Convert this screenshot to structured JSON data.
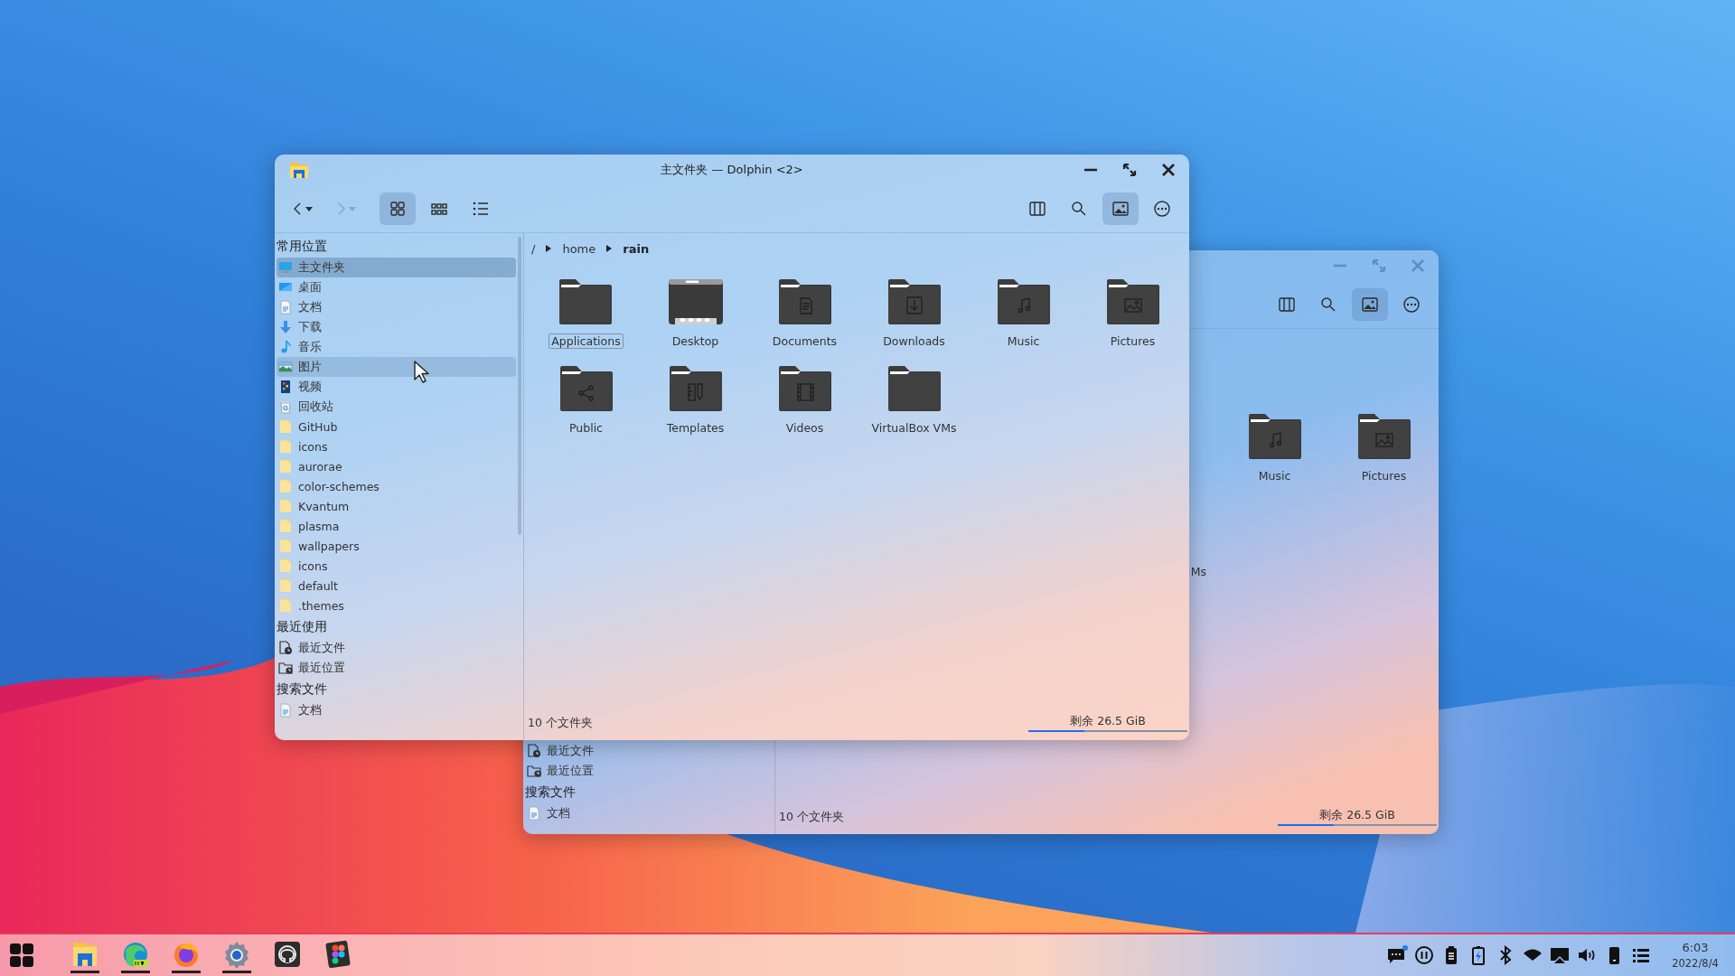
{
  "front_window": {
    "title": "主文件夹 — Dolphin <2>",
    "nav": [
      {
        "kind": "back",
        "disabled": false
      },
      {
        "kind": "forward",
        "disabled": true
      }
    ],
    "view_modes": [
      {
        "kind": "icons",
        "selected": true
      },
      {
        "kind": "compact",
        "selected": false
      },
      {
        "kind": "details",
        "selected": false
      }
    ],
    "tools": [
      {
        "kind": "split",
        "on": false
      },
      {
        "kind": "search",
        "on": false
      },
      {
        "kind": "preview",
        "on": true
      },
      {
        "kind": "menu",
        "on": false
      }
    ],
    "sidebar": [
      {
        "heading": "常用位置",
        "items": [
          {
            "label": "主文件夹",
            "kind": "computer",
            "selected": true,
            "hovered": false
          },
          {
            "label": "桌面",
            "kind": "desktop",
            "selected": false,
            "hovered": false
          },
          {
            "label": "文档",
            "kind": "document",
            "selected": false,
            "hovered": false
          },
          {
            "label": "下载",
            "kind": "download",
            "selected": false,
            "hovered": false
          },
          {
            "label": "音乐",
            "kind": "music",
            "selected": false,
            "hovered": false
          },
          {
            "label": "图片",
            "kind": "picture",
            "selected": false,
            "hovered": true
          },
          {
            "label": "视频",
            "kind": "video",
            "selected": false,
            "hovered": false
          },
          {
            "label": "回收站",
            "kind": "trash",
            "selected": false,
            "hovered": false
          },
          {
            "label": "GitHub",
            "kind": "folder",
            "selected": false,
            "hovered": false
          },
          {
            "label": "icons",
            "kind": "folder",
            "selected": false,
            "hovered": false
          },
          {
            "label": "aurorae",
            "kind": "folder",
            "selected": false,
            "hovered": false
          },
          {
            "label": "color-schemes",
            "kind": "folder",
            "selected": false,
            "hovered": false
          },
          {
            "label": "Kvantum",
            "kind": "folder",
            "selected": false,
            "hovered": false
          },
          {
            "label": "plasma",
            "kind": "folder",
            "selected": false,
            "hovered": false
          },
          {
            "label": "wallpapers",
            "kind": "folder",
            "selected": false,
            "hovered": false
          },
          {
            "label": "icons",
            "kind": "folder",
            "selected": false,
            "hovered": false
          },
          {
            "label": "default",
            "kind": "folder",
            "selected": false,
            "hovered": false
          },
          {
            "label": ".themes",
            "kind": "folder",
            "selected": false,
            "hovered": false
          }
        ]
      },
      {
        "heading": "最近使用",
        "items": [
          {
            "label": "最近文件",
            "kind": "recent-file",
            "selected": false,
            "hovered": false
          },
          {
            "label": "最近位置",
            "kind": "recent-place",
            "selected": false,
            "hovered": false
          }
        ]
      },
      {
        "heading": "搜索文件",
        "items": [
          {
            "label": "文档",
            "kind": "document",
            "selected": false,
            "hovered": false
          }
        ]
      }
    ],
    "breadcrumb": [
      {
        "label": "/",
        "current": false
      },
      {
        "label": "home",
        "current": false
      },
      {
        "label": "rain",
        "current": true
      }
    ],
    "folders": [
      {
        "label": "Applications",
        "kind": "plain",
        "focused": true
      },
      {
        "label": "Desktop",
        "kind": "desktop",
        "focused": false
      },
      {
        "label": "Documents",
        "kind": "document",
        "focused": false
      },
      {
        "label": "Downloads",
        "kind": "download",
        "focused": false
      },
      {
        "label": "Music",
        "kind": "music",
        "focused": false
      },
      {
        "label": "Pictures",
        "kind": "picture",
        "focused": false
      },
      {
        "label": "Public",
        "kind": "share",
        "focused": false
      },
      {
        "label": "Templates",
        "kind": "template",
        "focused": false
      },
      {
        "label": "Videos",
        "kind": "video",
        "focused": false
      },
      {
        "label": "VirtualBox VMs",
        "kind": "plain",
        "focused": false
      }
    ],
    "status": {
      "count": "10 个文件夹",
      "free": "剩余 26.5 GiB",
      "level": 0.35
    }
  },
  "back_window": {
    "tools": [
      {
        "kind": "split",
        "on": false
      },
      {
        "kind": "search",
        "on": false
      },
      {
        "kind": "preview",
        "on": true
      },
      {
        "kind": "menu",
        "on": false
      }
    ],
    "sidebar": [
      {
        "items": [
          {
            "label": "最近文件",
            "kind": "recent-file",
            "selected": false,
            "hovered": false
          },
          {
            "label": "最近位置",
            "kind": "recent-place",
            "selected": false,
            "hovered": false
          }
        ]
      },
      {
        "heading": "搜索文件",
        "items": [
          {
            "label": "文档",
            "kind": "document",
            "selected": false,
            "hovered": false
          }
        ]
      }
    ],
    "folders": [
      {
        "kind": "music",
        "label": "Music",
        "focused": false
      },
      {
        "kind": "picture",
        "label": "Pictures",
        "focused": false
      },
      {
        "kind": "label-tail",
        "label": "Ms"
      }
    ],
    "status": {
      "count": "10 个文件夹",
      "free": "剩余 26.5 GiB",
      "level": 0.35
    }
  },
  "taskbar": {
    "apps": [
      {
        "kind": "file-manager",
        "running": true
      },
      {
        "kind": "browser-edge",
        "running": true
      },
      {
        "kind": "browser-firefox",
        "running": true
      },
      {
        "kind": "settings",
        "running": true
      },
      {
        "kind": "github",
        "running": false
      },
      {
        "kind": "figma",
        "running": false
      }
    ],
    "tray": [
      {
        "kind": "chat",
        "badge": true
      },
      {
        "kind": "pause"
      },
      {
        "kind": "clipboard"
      },
      {
        "kind": "battery"
      },
      {
        "kind": "bluetooth"
      },
      {
        "kind": "wifi"
      },
      {
        "kind": "screen-cast"
      },
      {
        "kind": "volume"
      },
      {
        "kind": "phone"
      },
      {
        "kind": "list"
      }
    ],
    "time": "6:03",
    "date": "2022/8/4"
  }
}
